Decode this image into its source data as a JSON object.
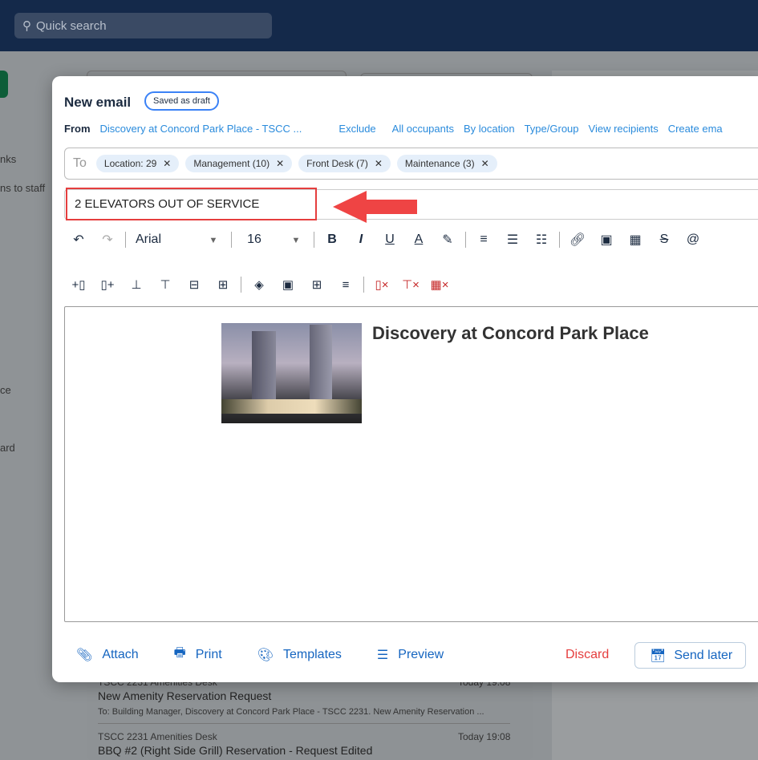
{
  "topbar": {
    "search_placeholder": "Quick search"
  },
  "background": {
    "sidebar_fragments": [
      "nks",
      "ns to staff",
      "ce",
      "ard"
    ],
    "list": [
      {
        "sender": "TSCC 2231 Amenities Desk",
        "time": "Today 19:08",
        "subject": "New Amenity Reservation Request",
        "preview": "To: Building Manager, Discovery at Concord Park Place - TSCC 2231. New Amenity Reservation ..."
      },
      {
        "sender": "TSCC 2231 Amenities Desk",
        "time": "Today 19:08",
        "subject": "BBQ #2 (Right Side Grill) Reservation - Request Edited"
      }
    ]
  },
  "modal": {
    "title": "New email",
    "status_badge": "Saved as draft",
    "from_label": "From",
    "from_value": "Discovery at Concord Park Place - TSCC ...",
    "links": [
      "Exclude",
      "All occupants",
      "By location",
      "Type/Group",
      "View recipients",
      "Create ema"
    ],
    "to_label": "To",
    "recipients": [
      "Location: 29",
      "Management (10)",
      "Front Desk (7)",
      "Maintenance (3)"
    ],
    "subject": "2 ELEVATORS OUT OF SERVICE",
    "toolbar": {
      "font": "Arial",
      "size": "16"
    },
    "body_heading": "Discovery at Concord Park Place",
    "footer": {
      "attach": "Attach",
      "print": "Print",
      "templates": "Templates",
      "preview": "Preview",
      "discard": "Discard",
      "send_later": "Send later"
    },
    "colors": {
      "accent": "#1565c0",
      "link": "#2a8bdc",
      "danger": "#e53e3e",
      "highlight": "#e53e3e"
    }
  }
}
